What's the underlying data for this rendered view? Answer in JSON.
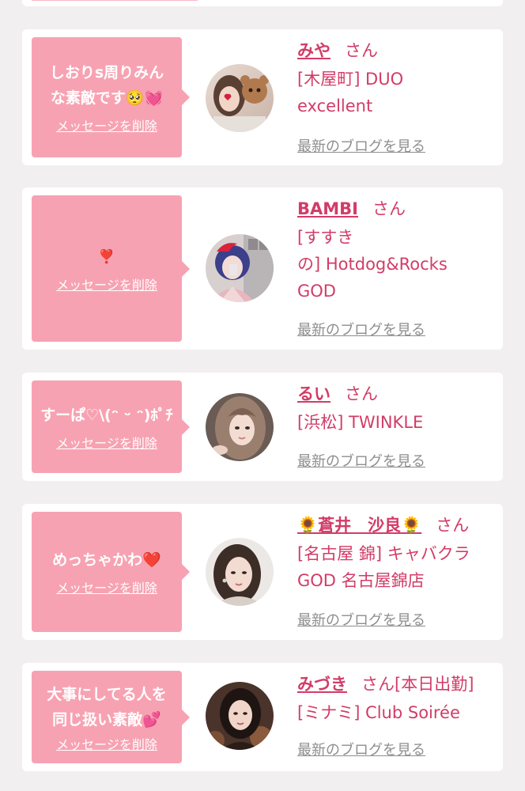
{
  "messages": [
    {
      "message_lines": [
        "しおりs周りみん",
        "な素敵です🥺💓"
      ],
      "delete_label": "メッセージを削除",
      "name": "みや",
      "honorific": "さん",
      "shop_lines": [
        "[木屋町] DUO",
        "excellent"
      ],
      "blog_link": "最新のブログを見る"
    },
    {
      "message_lines": [
        "❣️"
      ],
      "delete_label": "メッセージを削除",
      "name": "BAMBI",
      "honorific": "さん",
      "shop_lines": [
        "[すすき",
        "の] Hotdog&Rocks",
        "GOD"
      ],
      "blog_link": "最新のブログを見る"
    },
    {
      "message_lines": [
        "すーぱ♡\\(ᵔ ᵕ ᵔ)ﾎﾟﾁ"
      ],
      "delete_label": "メッセージを削除",
      "name": "るい",
      "honorific": "さん",
      "shop_lines": [
        "[浜松] TWINKLE"
      ],
      "blog_link": "最新のブログを見る"
    },
    {
      "message_lines": [
        "めっちゃかわ❤️"
      ],
      "delete_label": "メッセージを削除",
      "name": "🌻蒼井　沙良🌻",
      "honorific": "さん",
      "shop_lines": [
        "[名古屋 錦] キャバクラ",
        "GOD 名古屋錦店"
      ],
      "blog_link": "最新のブログを見る"
    },
    {
      "message_lines": [
        "大事にしてる人を",
        "同じ扱い素敵💕"
      ],
      "delete_label": "メッセージを削除",
      "name": "みづき",
      "honorific": "さん[本日出勤]",
      "shop_lines": [
        "[ミナミ] Club Soirée"
      ],
      "blog_link": "最新のブログを見る"
    }
  ],
  "colors": {
    "page_background": "#f2eff1",
    "card_background": "#ffffff",
    "bubble": "#f7a2b2",
    "accent_text": "#d23c67",
    "link_gray": "#8e8e8e"
  }
}
